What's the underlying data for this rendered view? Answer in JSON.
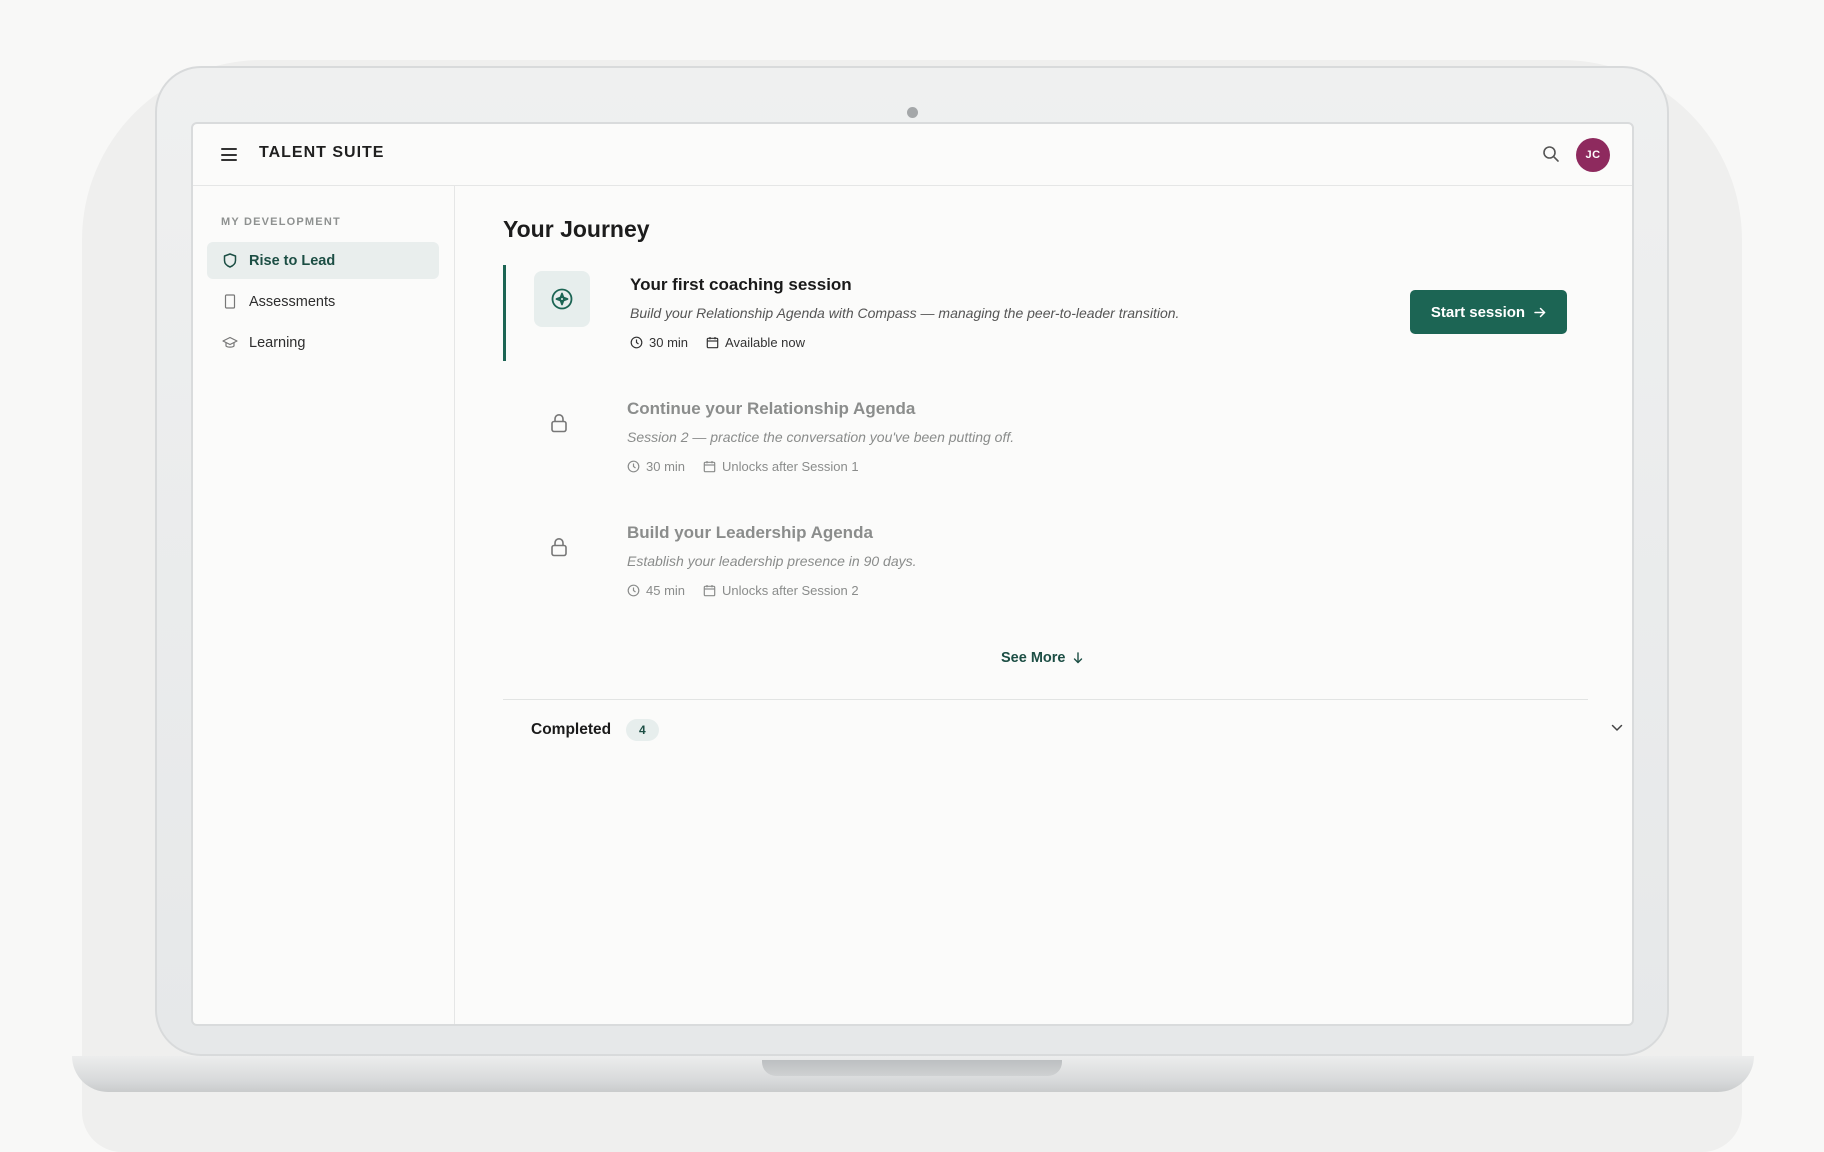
{
  "app": {
    "title": "TALENT SUITE",
    "user_initials": "JC"
  },
  "colors": {
    "accent": "#1c6554",
    "avatar": "#8e2a5e"
  },
  "sidebar": {
    "section_label": "MY DEVELOPMENT",
    "items": [
      {
        "label": "Rise to Lead",
        "icon": "shield-icon",
        "active": true
      },
      {
        "label": "Assessments",
        "icon": "document-icon",
        "active": false
      },
      {
        "label": "Learning",
        "icon": "graduation-cap-icon",
        "active": false
      }
    ]
  },
  "main": {
    "title": "Your Journey",
    "sessions": [
      {
        "title": "Your first coaching session",
        "description": "Build your Relationship Agenda with Compass — managing the peer-to-leader transition.",
        "duration": "30 min",
        "availability": "Available now",
        "icon": "compass-icon",
        "state": "current",
        "button_label": "Start session"
      },
      {
        "title": "Continue your Relationship Agenda",
        "description": "Session 2 — practice the conversation you've been putting off.",
        "duration": "30 min",
        "availability": "Unlocks after Session 1",
        "icon": "lock-icon",
        "state": "locked"
      },
      {
        "title": "Build your Leadership Agenda",
        "description": "Establish your leadership presence in 90 days.",
        "duration": "45 min",
        "availability": "Unlocks after Session 2",
        "icon": "lock-icon",
        "state": "locked"
      }
    ],
    "see_more_label": "See More",
    "completed": {
      "label": "Completed",
      "count": "4"
    }
  }
}
